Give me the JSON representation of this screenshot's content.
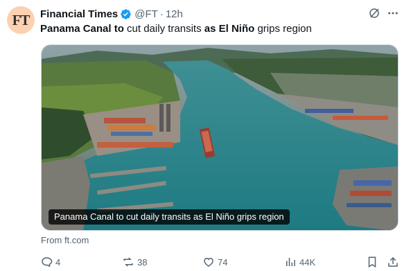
{
  "author": {
    "avatar_text": "FT",
    "name": "Financial Times",
    "handle": "@FT",
    "separator": "·",
    "time": "12h"
  },
  "tweet": {
    "part1": "Panama Canal to",
    "part2": " cut daily transits ",
    "part3": "as El Niño",
    "part4": " grips region"
  },
  "media": {
    "caption": "Panama Canal to cut daily transits as El Niño grips region"
  },
  "source": "From ft.com",
  "actions": {
    "replies": "4",
    "reposts": "38",
    "likes": "74",
    "views": "44K"
  },
  "icons": {
    "verified": "verified-badge-icon",
    "grok": "grok-icon",
    "more": "more-icon",
    "reply": "reply-icon",
    "repost": "repost-icon",
    "like": "like-icon",
    "views": "views-icon",
    "bookmark": "bookmark-icon",
    "share": "share-icon"
  },
  "colors": {
    "text": "#0f1419",
    "secondary": "#536471",
    "verified": "#1d9bf0",
    "avatar_bg": "#fcd0b1"
  }
}
